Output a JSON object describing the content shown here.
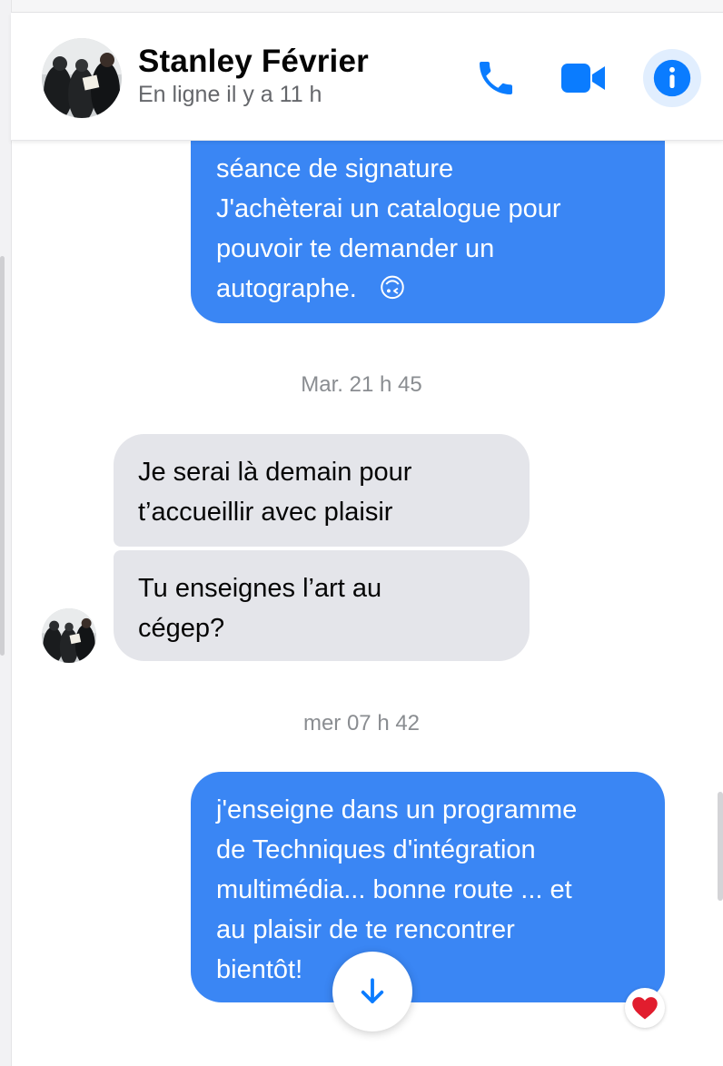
{
  "header": {
    "contact_name": "Stanley Février",
    "status": "En ligne il y a 11 h",
    "actions": [
      {
        "icon": "phone-icon",
        "label": "call"
      },
      {
        "icon": "video-camera-icon",
        "label": "video call"
      },
      {
        "icon": "info-icon",
        "label": "conversation info"
      }
    ]
  },
  "colors": {
    "accent": "#0a7cff",
    "outgoing_bubble": "#3a86f4",
    "incoming_bubble": "#e4e5ea",
    "info_button_bg": "#e1eefe"
  },
  "messages": {
    "m1": {
      "direction": "outgoing",
      "lines": [
        "séance de signature",
        "J'achèterai un catalogue pour",
        "pouvoir te demander un",
        "autographe."
      ],
      "emoji": "🙃"
    },
    "stamp1": "Mar. 21 h 45",
    "m2": {
      "direction": "incoming",
      "lines": [
        "Je serai là demain pour",
        "t’accueillir avec plaisir"
      ]
    },
    "m3": {
      "direction": "incoming",
      "lines": [
        "Tu enseignes l’art au",
        "cégep?"
      ]
    },
    "stamp2": "mer 07 h 42",
    "m4": {
      "direction": "outgoing",
      "lines": [
        "j'enseigne dans un programme",
        "de Techniques d'intégration",
        "multimédia... bonne route ...  et",
        "au plaisir de te rencontrer",
        "bientôt!"
      ],
      "reaction": "❤️"
    }
  }
}
